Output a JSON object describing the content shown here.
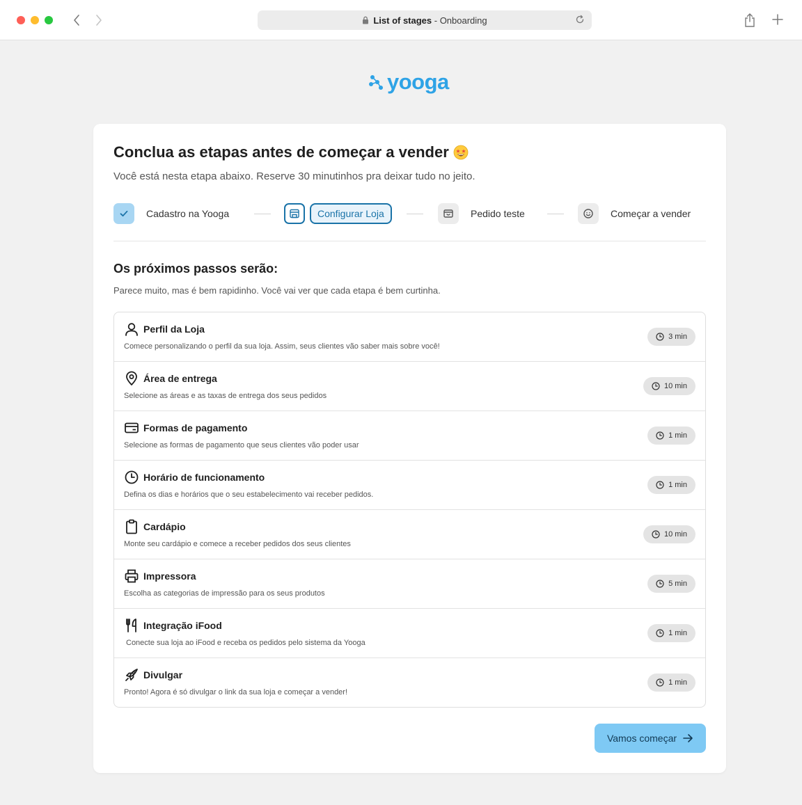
{
  "browser": {
    "page_title": "List of stages",
    "page_suffix": " - Onboarding"
  },
  "brand": {
    "name": "yooga",
    "color": "#2ea3e6"
  },
  "card": {
    "title": "Conclua as etapas antes de começar a vender",
    "subtitle": "Você está nesta etapa abaixo. Reserve 30 minutinhos pra deixar tudo no jeito."
  },
  "stepper": {
    "steps": [
      {
        "label": "Cadastro na Yooga",
        "state": "done",
        "icon": "check-icon"
      },
      {
        "label": "Configurar Loja",
        "state": "active",
        "icon": "store-icon"
      },
      {
        "label": "Pedido teste",
        "state": "todo",
        "icon": "box-icon"
      },
      {
        "label": "Começar a vender",
        "state": "todo",
        "icon": "smile-icon"
      }
    ],
    "colors": {
      "done_bg": "#a8d6f3",
      "active": "#1a73a8",
      "todo_bg": "#ececec"
    }
  },
  "next_steps": {
    "title": "Os próximos passos serão:",
    "subtitle": "Parece muito, mas é bem rapidinho. Você vai ver que cada etapa é bem curtinha.",
    "items": [
      {
        "title": "Perfil da Loja",
        "desc": "Comece personalizando o perfil da sua loja. Assim, seus clientes vão saber mais sobre você!",
        "time": "3 min",
        "icon": "user-icon"
      },
      {
        "title": "Área de entrega",
        "desc": "Selecione as áreas e as taxas de entrega dos seus pedidos",
        "time": "10 min",
        "icon": "location-pin-icon"
      },
      {
        "title": "Formas de pagamento",
        "desc": "Selecione as formas de pagamento que seus clientes vão poder usar",
        "time": "1 min",
        "icon": "credit-card-icon"
      },
      {
        "title": "Horário de funcionamento",
        "desc": "Defina os dias e horários que o seu estabelecimento vai receber pedidos.",
        "time": "1 min",
        "icon": "clock-icon"
      },
      {
        "title": "Cardápio",
        "desc": "Monte seu cardápio e comece a receber pedidos dos seus clientes",
        "time": "10 min",
        "icon": "clipboard-icon"
      },
      {
        "title": "Impressora",
        "desc": "Escolha as categorias de impressão para os seus produtos",
        "time": "5 min",
        "icon": "printer-icon"
      },
      {
        "title": "Integração iFood",
        "desc": "Conecte sua loja ao iFood e receba os pedidos pelo sistema da Yooga",
        "time": "1 min",
        "icon": "fork-knife-icon"
      },
      {
        "title": "Divulgar",
        "desc": "Pronto! Agora é só divulgar o link da sua loja e começar a vender!",
        "time": "1 min",
        "icon": "rocket-icon"
      }
    ]
  },
  "cta": {
    "label": "Vamos começar",
    "color": "#7ec9f4"
  }
}
